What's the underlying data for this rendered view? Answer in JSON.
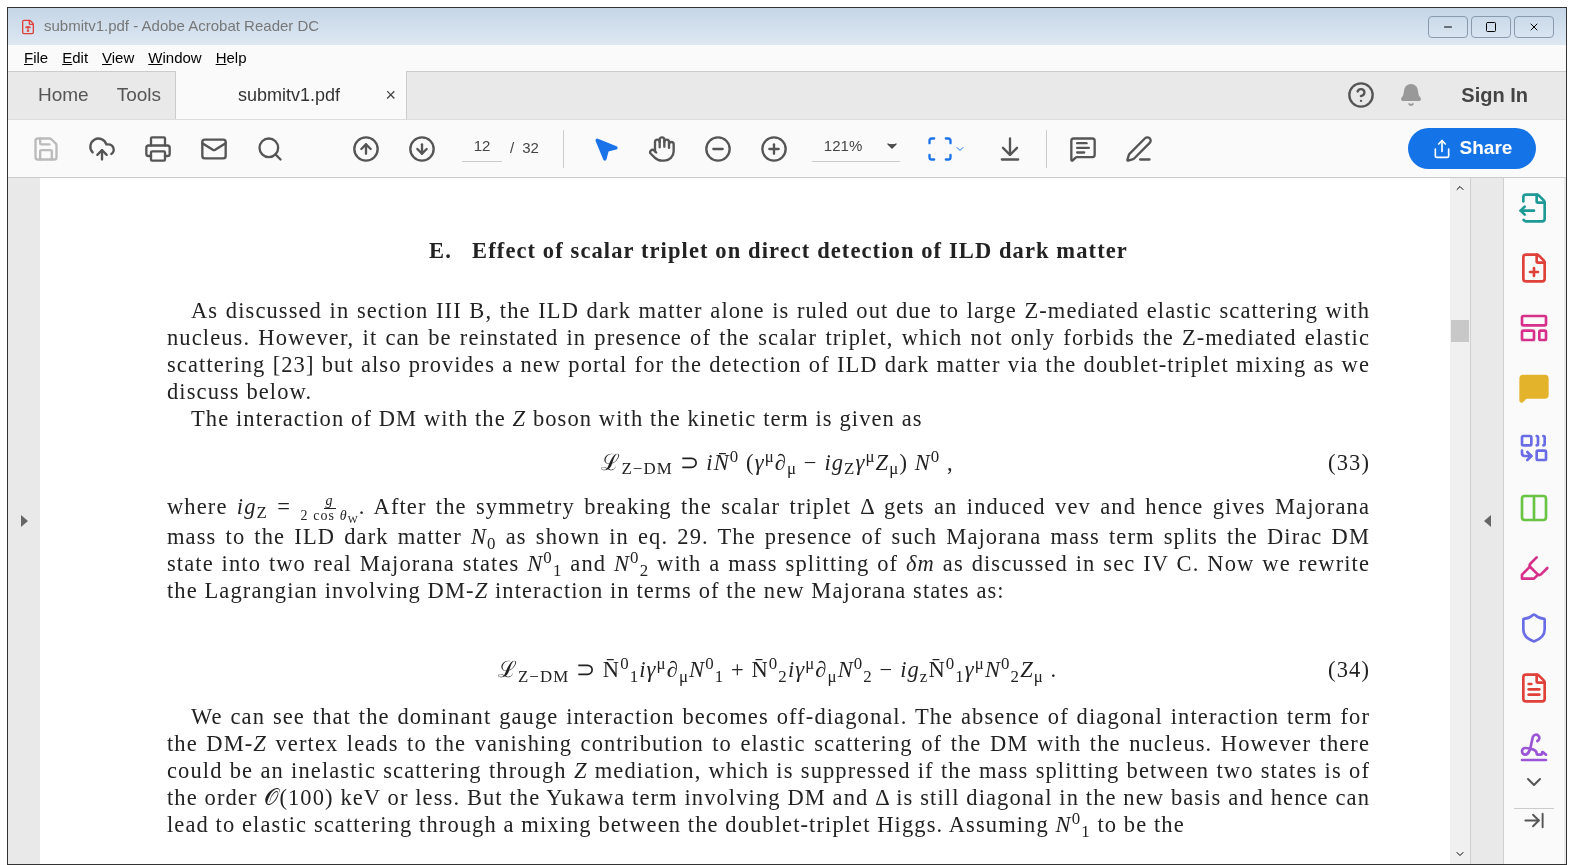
{
  "window": {
    "title": "submitv1.pdf - Adobe Acrobat Reader DC"
  },
  "menu": [
    "File",
    "Edit",
    "View",
    "Window",
    "Help"
  ],
  "tabs": [
    {
      "label": "Home",
      "selected": false
    },
    {
      "label": "Tools",
      "selected": false
    },
    {
      "label": "submitv1.pdf",
      "selected": true,
      "close": "×"
    }
  ],
  "sign_in": "Sign In",
  "toolbar": {
    "page_current": "12",
    "page_separator": "/",
    "page_total": "32",
    "zoom": "121%",
    "share": "Share"
  },
  "document": {
    "heading": "E.   Effect of scalar triplet on direct detection of ILD dark matter",
    "blocks": [
      {
        "kind": "paragraph",
        "text": "As discussed in section III B, the ILD dark matter alone is ruled out due to large Z-mediated elastic scattering with nucleus. However, it can be reinstated in presence of the scalar triplet, which not only forbids the Z-mediated elastic scattering [23] but also provides a new portal for the detection of ILD dark matter via the doublet-triplet mixing as we discuss below."
      },
      {
        "kind": "paragraph",
        "text": "The interaction of DM with the *Z* boson with the kinetic term is given as"
      },
      {
        "kind": "equation",
        "text": "ℒ$_{Z−DM}$ ⊃ *iN̄*$^{0}$ (*γ*$^{μ}$∂$_{μ}$ − *ig*$_{Z}$*γ*$^{μ}$*Z*$_{μ}$) *N*$^{0}$ ,",
        "number": "(33)"
      },
      {
        "kind": "fraction_paragraph",
        "before": "where *ig*$_{Z}$ = ",
        "numerator": "*g*",
        "denominator": "2 cos *θ*$_{W}$",
        "after": ". After the symmetry breaking the scalar triplet Δ gets an induced vev and hence gives Majorana mass to the ILD dark matter *N*$_{0}$ as shown in eq. 29. The presence of such Majorana mass term splits the Dirac DM state into two real Majorana states *N*$^{0}$$_{1}$ and *N*$^{0}$$_{2}$ with a mass splitting of *δm* as discussed in sec IV C. Now we rewrite the Lagrangian involving DM-*Z* interaction in terms of the new Majorana states as:"
      },
      {
        "kind": "equation",
        "text": "ℒ$_{Z−DM}$ ⊃ N̄$^{0}$$_{1}$*iγ*$^{μ}$∂$_{μ}$*N*$^{0}$$_{1}$ + N̄$^{0}$$_{2}$*iγ*$^{μ}$∂$_{μ}$*N*$^{0}$$_{2}$ − *ig*$_{z}$N̄$^{0}$$_{1}$*γ*$^{μ}$*N*$^{0}$$_{2}$*Z*$_{μ}$ .",
        "number": "(34)"
      },
      {
        "kind": "paragraph",
        "text": "We can see that the dominant gauge interaction becomes off-diagonal. The absence of diagonal interaction term for the DM-*Z* vertex leads to the vanishing contribution to elastic scattering of the DM with the nucleus. However there could be an inelastic scattering through *Z* mediation, which is suppressed if the mass splitting between two states is of the order 𝒪(100) keV or less. But the Yukawa term involving DM and Δ is still diagonal in the new basis and hence can lead to elastic scattering through a mixing between the doublet-triplet Higgs. Assuming *N*$^{0}$$_{1}$ to be the"
      }
    ]
  }
}
